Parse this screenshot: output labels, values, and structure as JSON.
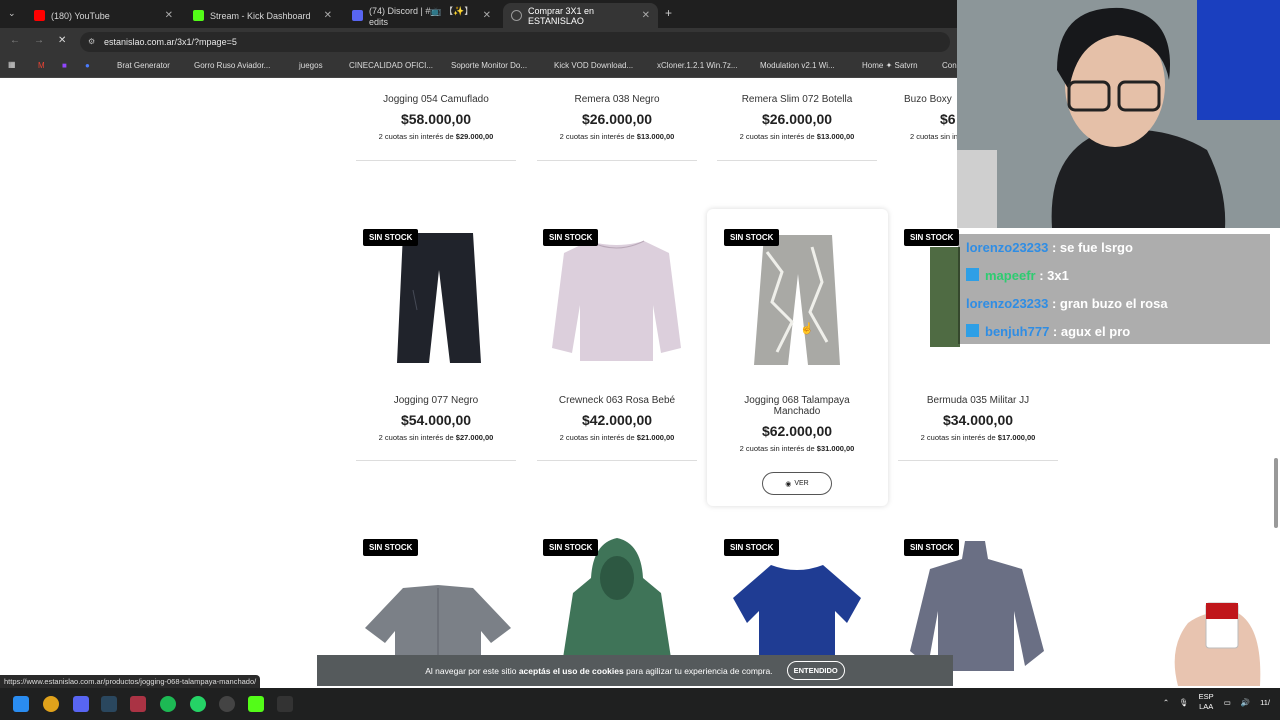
{
  "browser": {
    "tabs": [
      {
        "label": "(180) YouTube",
        "color": "#ff0000",
        "active": false
      },
      {
        "label": "Stream - Kick Dashboard",
        "color": "#53fc18",
        "active": false
      },
      {
        "label": "(74) Discord | #📺 【✨】 edits",
        "color": "#5865f2",
        "active": false
      },
      {
        "label": "Comprar 3X1 en ESTANISLAO",
        "color": "#888888",
        "active": true
      }
    ],
    "url": "estanislao.com.ar/3x1/?mpage=5",
    "bookmarks": [
      "Brat Generator",
      "Gorro Ruso Aviador...",
      "juegos",
      "CINECALIDAD OFICI...",
      "Soporte Monitor Do...",
      "Kick VOD Download...",
      "xCloner.1.2.1 Win.7z...",
      "Modulation v2.1 Wi...",
      "Home ✦ Satvrn",
      "Con"
    ]
  },
  "store": {
    "badge": "SIN STOCK",
    "row1": [
      {
        "name": "Jogging 054 Camuflado",
        "price": "$58.000,00",
        "inst_pre": "2 cuotas sin interés de",
        "inst_amt": "$29.000,00"
      },
      {
        "name": "Remera 038 Negro",
        "price": "$26.000,00",
        "inst_pre": "2 cuotas sin interés de",
        "inst_amt": "$13.000,00"
      },
      {
        "name": "Remera Slim 072 Botella",
        "price": "$26.000,00",
        "inst_pre": "2 cuotas sin interés de",
        "inst_amt": "$13.000,00"
      },
      {
        "name": "Buzo Boxy",
        "price": "$6",
        "inst_pre": "2 cuotas sin interés",
        "inst_amt": ""
      }
    ],
    "row2": [
      {
        "name": "Jogging 077 Negro",
        "price": "$54.000,00",
        "inst_pre": "2 cuotas sin interés de",
        "inst_amt": "$27.000,00"
      },
      {
        "name": "Crewneck 063 Rosa Bebé",
        "price": "$42.000,00",
        "inst_pre": "2 cuotas sin interés de",
        "inst_amt": "$21.000,00"
      },
      {
        "name": "Jogging 068 Talampaya Manchado",
        "price": "$62.000,00",
        "inst_pre": "2 cuotas sin interés de",
        "inst_amt": "$31.000,00"
      },
      {
        "name": "Bermuda 035 Militar JJ",
        "price": "$34.000,00",
        "inst_pre": "2 cuotas sin interés de",
        "inst_amt": "$17.000,00"
      }
    ],
    "ver_label": "VER",
    "cookie": {
      "pre": "Al navegar por este sitio ",
      "bold": "aceptás el uso de cookies",
      "post": " para agilizar tu experiencia de compra.",
      "button": "ENTENDIDO"
    },
    "status_url": "https://www.estanislao.com.ar/productos/jogging-068-talampaya-manchado/"
  },
  "chat": [
    {
      "user": "lorenzo23233",
      "text": " : se fue lsrgo",
      "style": "u1",
      "kick": false
    },
    {
      "user": "mapeefr",
      "text": " : 3x1",
      "style": "u2",
      "kick": true
    },
    {
      "user": "lorenzo23233",
      "text": " : gran buzo el rosa",
      "style": "u1",
      "kick": false
    },
    {
      "user": "benjuh777",
      "text": " : agux el pro",
      "style": "u1",
      "kick": true
    }
  ],
  "tray": {
    "lang": "ESP",
    "layout": "LAA",
    "time": "11/"
  }
}
